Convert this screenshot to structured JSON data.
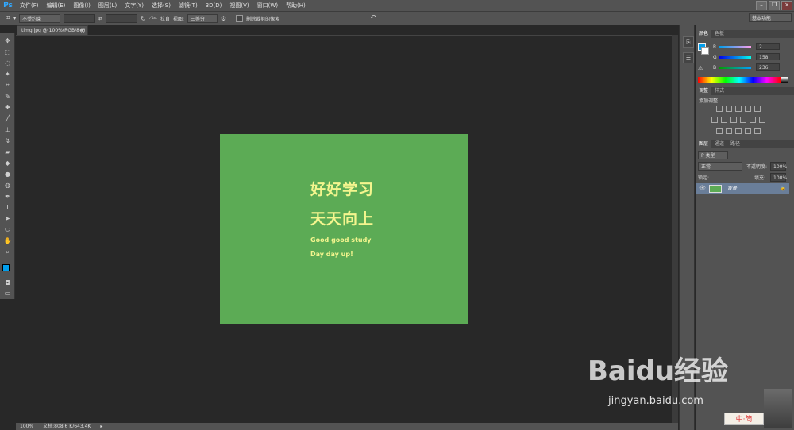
{
  "menubar": {
    "logo": "Ps",
    "items": [
      "文件(F)",
      "编辑(E)",
      "图像(I)",
      "图层(L)",
      "文字(Y)",
      "选择(S)",
      "滤镜(T)",
      "3D(D)",
      "视图(V)",
      "窗口(W)",
      "帮助(H)"
    ]
  },
  "options": {
    "ratio_preset": "不受约束",
    "swap": "⇄",
    "straighten_label": "拉直",
    "view_label": "视图:",
    "view_value": "三等分",
    "delete_cropped_label": "删除裁剪的像素",
    "workspace": "基本功能"
  },
  "document": {
    "tab_title": "timg.jpg @ 100%(RGB/8#)",
    "close": "×"
  },
  "canvas": {
    "line1": "好好学习",
    "line2": "天天向上",
    "line3": "Good good study",
    "line4": "Day day up!",
    "bg": "#5cab55",
    "text_color": "#f4f58e"
  },
  "status": {
    "zoom": "100%",
    "doc": "文档:808.6 K/643.4K"
  },
  "panels": {
    "color": {
      "tabs": [
        "颜色",
        "色板"
      ],
      "channels": [
        {
          "label": "R",
          "value": "2"
        },
        {
          "label": "G",
          "value": "158"
        },
        {
          "label": "B",
          "value": "236"
        }
      ]
    },
    "adjustments": {
      "tabs": [
        "调整",
        "样式"
      ],
      "add_label": "添加调整"
    },
    "layers": {
      "tabs": [
        "图层",
        "通道",
        "路径"
      ],
      "filter_label": "P 类型",
      "blend": "正常",
      "opacity_label": "不透明度:",
      "opacity": "100%",
      "lock_label": "锁定:",
      "fill_label": "填充:",
      "fill": "100%",
      "layer_name": "背景"
    }
  },
  "watermark": {
    "brand": "Baidu经验",
    "url": "jingyan.baidu.com",
    "ime": "中·简"
  }
}
